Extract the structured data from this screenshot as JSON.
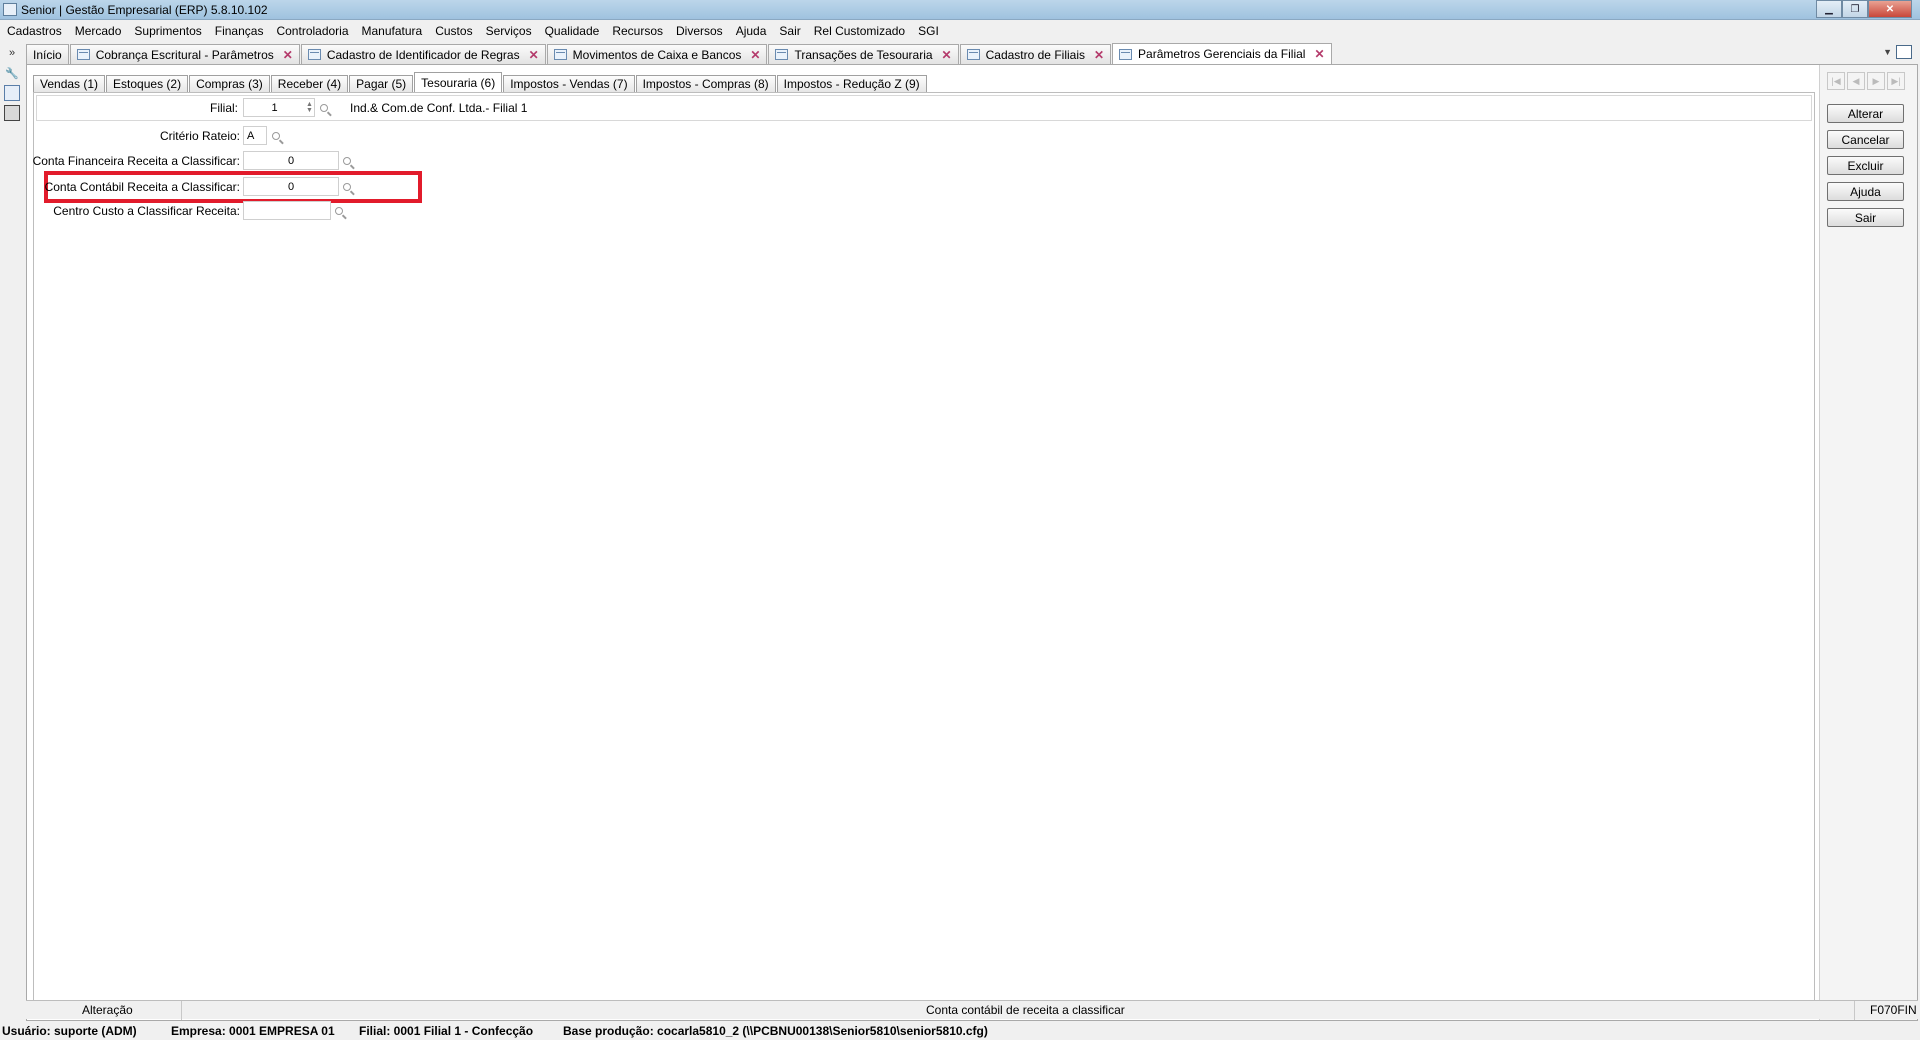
{
  "window": {
    "title": "Senior | Gestão Empresarial (ERP) 5.8.10.102"
  },
  "menu": [
    "Cadastros",
    "Mercado",
    "Suprimentos",
    "Finanças",
    "Controladoria",
    "Manufatura",
    "Custos",
    "Serviços",
    "Qualidade",
    "Recursos",
    "Diversos",
    "Ajuda",
    "Sair",
    "Rel Customizado",
    "SGI"
  ],
  "doc_tabs": {
    "home": "Início",
    "t1": "Cobrança Escritural - Parâmetros",
    "t2": "Cadastro de Identificador de Regras",
    "t3": "Movimentos de Caixa e Bancos",
    "t4": "Transações de Tesouraria",
    "t5": "Cadastro de Filiais",
    "t6": "Parâmetros Gerenciais da Filial"
  },
  "sub_tabs": [
    "Vendas (1)",
    "Estoques (2)",
    "Compras (3)",
    "Receber (4)",
    "Pagar (5)",
    "Tesouraria (6)",
    "Impostos - Vendas (7)",
    "Impostos - Compras (8)",
    "Impostos - Redução Z (9)"
  ],
  "form": {
    "filial_label": "Filial:",
    "filial_value": "1",
    "filial_desc": "Ind.& Com.de Conf. Ltda.- Filial 1",
    "criterio_label": "Critério Rateio:",
    "criterio_value": "A",
    "conta_fin_label": "Conta Financeira Receita a Classificar:",
    "conta_fin_value": "0",
    "conta_cont_label": "Conta Contábil Receita a Classificar:",
    "conta_cont_value": "0",
    "centro_custo_label": "Centro Custo a Classificar Receita:",
    "centro_custo_value": ""
  },
  "actions": {
    "alterar": "Alterar",
    "cancelar": "Cancelar",
    "excluir": "Excluir",
    "ajuda": "Ajuda",
    "sair": "Sair"
  },
  "status": {
    "mode": "Alteração",
    "hint": "Conta contábil de receita a classificar",
    "form_code": "F070FIN"
  },
  "bottom": {
    "usuario": "Usuário: suporte (ADM)",
    "empresa": "Empresa: 0001 EMPRESA 01",
    "filial": "Filial: 0001 Filial 1 - Confecção",
    "base": "Base produção: cocarla5810_2 (\\\\PCBNU00138\\Senior5810\\senior5810.cfg)"
  },
  "colors": {
    "highlight": "#e21b2b",
    "titlebar": "#bcd6ea"
  }
}
